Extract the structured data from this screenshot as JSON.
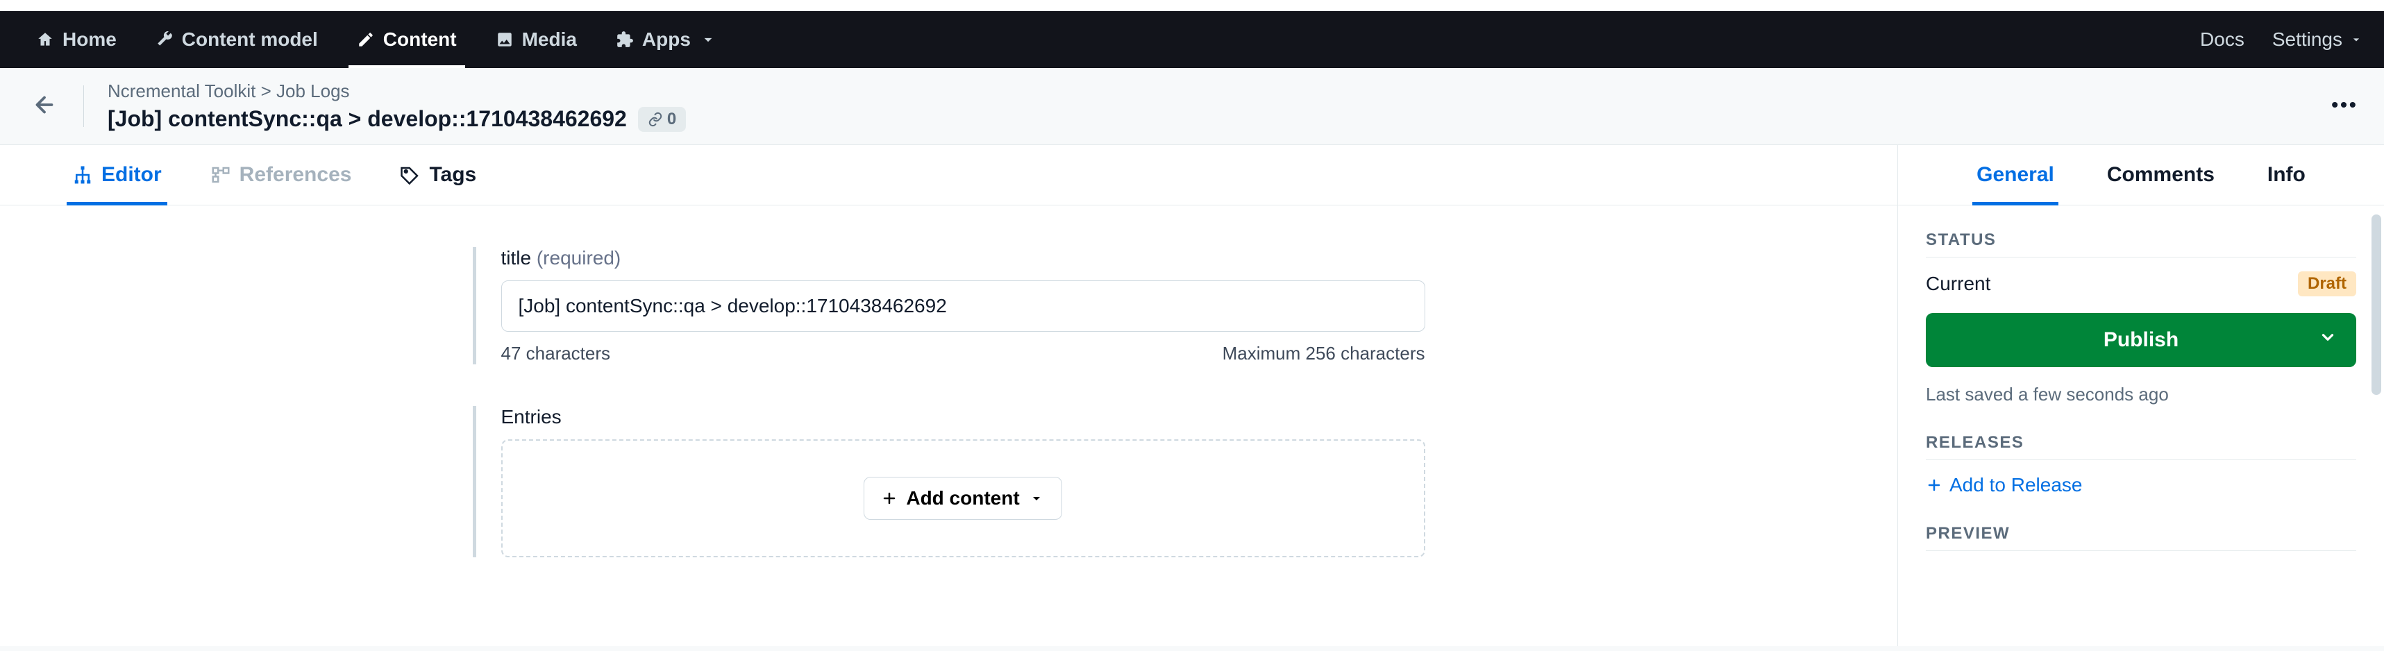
{
  "topnav": {
    "items": [
      {
        "label": "Home"
      },
      {
        "label": "Content model"
      },
      {
        "label": "Content"
      },
      {
        "label": "Media"
      },
      {
        "label": "Apps"
      }
    ],
    "right": {
      "docs": "Docs",
      "settings": "Settings"
    }
  },
  "header": {
    "breadcrumb": "Ncremental Toolkit > Job Logs",
    "title": "[Job] contentSync::qa > develop::1710438462692",
    "link_count": "0"
  },
  "editor_tabs": {
    "editor": "Editor",
    "references": "References",
    "tags": "Tags"
  },
  "form": {
    "title_field": {
      "label": "title",
      "required": "(required)",
      "value": "[Job] contentSync::qa > develop::1710438462692",
      "char_count": "47 characters",
      "max": "Maximum 256 characters"
    },
    "entries": {
      "label": "Entries",
      "add_content": "Add content"
    }
  },
  "sidebar": {
    "tabs": {
      "general": "General",
      "comments": "Comments",
      "info": "Info"
    },
    "status": {
      "heading": "STATUS",
      "current_label": "Current",
      "badge": "Draft",
      "publish": "Publish",
      "last_saved": "Last saved a few seconds ago"
    },
    "releases": {
      "heading": "RELEASES",
      "add": "Add to Release"
    },
    "preview": {
      "heading": "PREVIEW"
    }
  }
}
